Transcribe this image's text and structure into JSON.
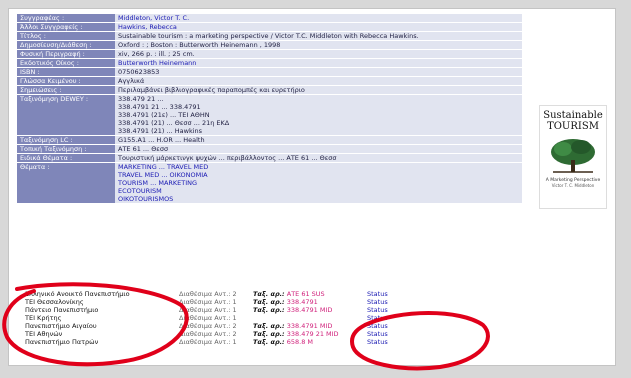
{
  "record": {
    "rows": [
      {
        "label": "Συγγραφέας :",
        "lines": [
          "Middleton, Victor T. C."
        ],
        "link": true
      },
      {
        "label": "Άλλοι Συγγραφείς :",
        "lines": [
          "Hawkins, Rebecca"
        ],
        "link": true
      },
      {
        "label": "Τίτλος :",
        "lines": [
          "Sustainable tourism : a marketing perspective / Victor T.C. Middleton with Rebecca Hawkins."
        ],
        "link": false
      },
      {
        "label": "Δημοσίευση/Διάθεση :",
        "lines": [
          "Oxford : ; Boston : Butterworth Heinemann , 1998"
        ],
        "link": false
      },
      {
        "label": "Φυσική Περιγραφή :",
        "lines": [
          "xiv, 266 p. : ill. ; 25 cm."
        ],
        "link": false
      },
      {
        "label": "Εκδοτικός Οίκος :",
        "lines": [
          "Butterworth Heinemann"
        ],
        "link": true
      },
      {
        "label": "ISBN :",
        "lines": [
          "0750623853"
        ],
        "link": false
      },
      {
        "label": "Γλώσσα Κειμένου :",
        "lines": [
          "Αγγλικά"
        ],
        "link": false
      },
      {
        "label": "Σημειώσεις :",
        "lines": [
          "Περιλαμβάνει βιβλιογραφικές παραπομπές και ευρετήριο"
        ],
        "link": false
      },
      {
        "label": "Ταξινόμηση DEWEY :",
        "lines": [
          "338.479 21 ... ",
          "338.4791 21 ... 338.4791",
          "338.4791 (21ε) ... ΤΕΙ ΑΘΗΝ",
          "338.4791 (21) ... Θεσσ ... 21η ΕΚΔ",
          "338.4791 (21) ... Hawkins"
        ],
        "link": false
      },
      {
        "label": "Ταξινόμηση LC :",
        "lines": [
          "G155.A1 ... H.OR ... Health"
        ],
        "link": false
      },
      {
        "label": "Τοπική Ταξινόμηση :",
        "lines": [
          "ΑΤΕ 61 ... Θεσσ"
        ],
        "link": false
      },
      {
        "label": "Ειδικά Θέματα :",
        "lines": [
          "Τουριστική μάρκετινγκ ψυχών ... περιβάλλοντος ... ΑΤΕ 61 ... Θεσσ"
        ],
        "link": false
      },
      {
        "label": "Θέματα :",
        "lines": [
          "MARKETING ... TRAVEL MED",
          "TRAVEL MED ... OIKONOMIA",
          "TOURISM ... MARKETING",
          "ECOTOURISM",
          "OIKOTOURISMOS"
        ],
        "link": true
      }
    ]
  },
  "cover": {
    "title_line1": "Sustainable",
    "title_line2": "TOURISM",
    "subtitle": "A Marketing Perspective",
    "author": "Victor T. C. Middleton",
    "colors": {
      "tree": "#2e6b33"
    }
  },
  "holdings": {
    "call_prefix": "Ταξ. αρ.:",
    "rows": [
      {
        "library": "Ελληνικό Ανοικτό Πανεπιστήμιο",
        "availability": "Διαθέσιμα Αντ.: 2",
        "callno": "ΑΤΕ 61 SUS",
        "status": "Status"
      },
      {
        "library": "ΤΕΙ Θεσσαλονίκης",
        "availability": "Διαθέσιμα Αντ.: 1",
        "callno": "338.4791",
        "status": "Status"
      },
      {
        "library": "Πάντειο Πανεπιστήμιο",
        "availability": "Διαθέσιμα Αντ.: 1",
        "callno": "338.4791 MID",
        "status": "Status"
      },
      {
        "library": "ΤΕΙ Κρήτης",
        "availability": "Διαθέσιμα Αντ.: 1",
        "callno": "",
        "status": "Status"
      },
      {
        "library": "Πανεπιστήμιο Αιγαίου",
        "availability": "Διαθέσιμα Αντ.: 2",
        "callno": "338.4791 MID",
        "status": "Status"
      },
      {
        "library": "ΤΕΙ Αθηνών",
        "availability": "Διαθέσιμα Αντ.: 2",
        "callno": "338.479 21 MID",
        "status": "Status"
      },
      {
        "library": "Πανεπιστήμιο Πατρών",
        "availability": "Διαθέσιμα Αντ.: 1",
        "callno": "658.8 M",
        "status": "Status"
      }
    ]
  },
  "colors": {
    "label_bg": "#7f86b9",
    "value_bg": "#e1e4f0",
    "annotation": "#e0001a"
  }
}
